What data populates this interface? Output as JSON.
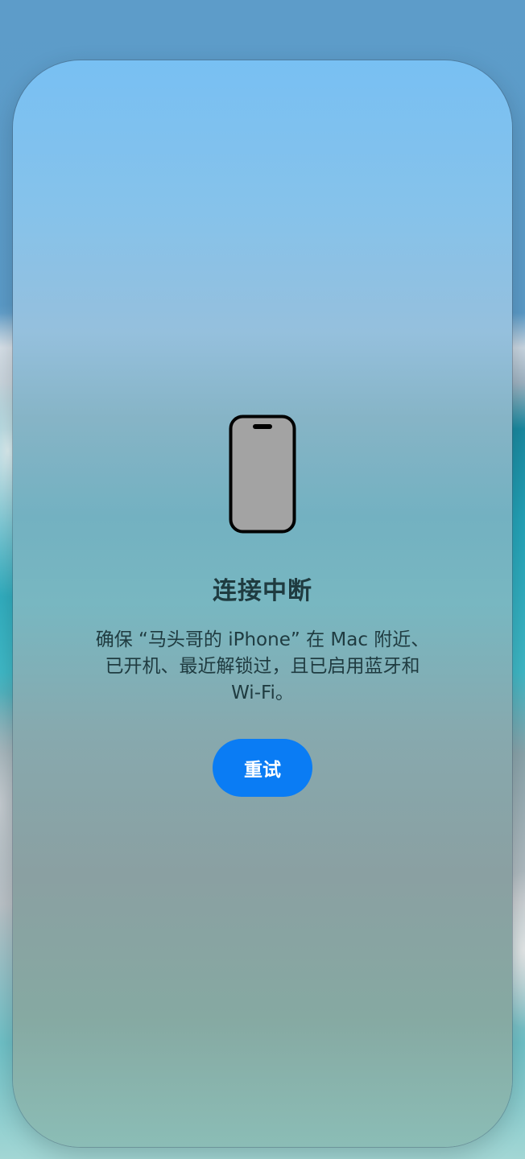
{
  "dialog": {
    "title": "连接中断",
    "message": "确保 “马头哥的 iPhone” 在 Mac 附近、已开机、最近解锁过，且已启用蓝牙和 Wi-Fi。",
    "retry_label": "重试",
    "icon": "iphone-icon"
  },
  "colors": {
    "accent": "#0a7cf4",
    "text": "#1f3b40"
  }
}
